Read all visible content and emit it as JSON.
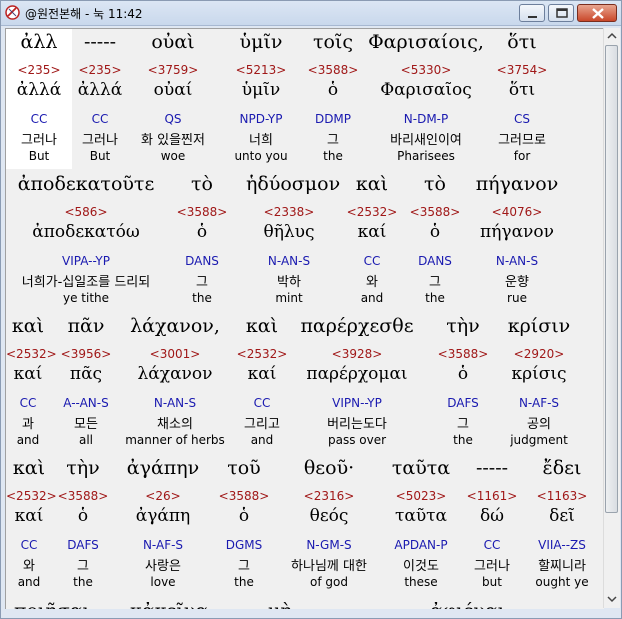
{
  "window": {
    "title": "@원전본해 - 눅 11:42"
  },
  "lines": [
    {
      "words": [
        {
          "greek": "ἀλλ",
          "num": "<235>",
          "lex": "ἀλλά",
          "pars": "CC",
          "kor": "그러나",
          "eng": "But"
        },
        {
          "greek": "-----",
          "num": "<235>",
          "lex": "ἀλλά",
          "pars": "CC",
          "kor": "그러나",
          "eng": "But"
        },
        {
          "greek": "οὐαὶ",
          "num": "<3759>",
          "lex": "οὐαί",
          "pars": "QS",
          "kor": "화 있을찐저",
          "eng": "woe"
        },
        {
          "greek": "ὑμῖν",
          "num": "<5213>",
          "lex": "ὑμῖν",
          "pars": "NPD-YP",
          "kor": "너희",
          "eng": "unto you"
        },
        {
          "greek": "τοῖς",
          "num": "<3588>",
          "lex": "ὁ",
          "pars": "DDMP",
          "kor": "그",
          "eng": "the"
        },
        {
          "greek": "Φαρισαίοις,",
          "num": "<5330>",
          "lex": "Φαρισαῖος",
          "pars": "N-DM-P",
          "kor": "바리새인이여",
          "eng": "Pharisees"
        },
        {
          "greek": "ὅτι",
          "num": "<3754>",
          "lex": "ὅτι",
          "pars": "CS",
          "kor": "그러므로",
          "eng": "for"
        }
      ]
    },
    {
      "words": [
        {
          "greek": "ἀποδεκατοῦτε",
          "num": "<586>",
          "lex": "ἀποδεκατόω",
          "pars": "VIPA--YP",
          "kor": "너희가-십일조를 드리되",
          "eng": "ye tithe"
        },
        {
          "greek": "τὸ",
          "num": "<3588>",
          "lex": "ὁ",
          "pars": "DANS",
          "kor": "그",
          "eng": "the"
        },
        {
          "greek": "ἡδύοσμον",
          "num": "<2338>",
          "lex": "θῆλυς",
          "pars": "N-AN-S",
          "kor": "박하",
          "eng": "mint"
        },
        {
          "greek": "καὶ",
          "num": "<2532>",
          "lex": "καί",
          "pars": "CC",
          "kor": "와",
          "eng": "and"
        },
        {
          "greek": "τὸ",
          "num": "<3588>",
          "lex": "ὁ",
          "pars": "DANS",
          "kor": "그",
          "eng": "the"
        },
        {
          "greek": "πήγανον",
          "num": "<4076>",
          "lex": "πήγανον",
          "pars": "N-AN-S",
          "kor": "운향",
          "eng": "rue"
        }
      ]
    },
    {
      "words": [
        {
          "greek": "καὶ",
          "num": "<2532>",
          "lex": "καί",
          "pars": "CC",
          "kor": "과",
          "eng": "and"
        },
        {
          "greek": "πᾶν",
          "num": "<3956>",
          "lex": "πᾶς",
          "pars": "A--AN-S",
          "kor": "모든",
          "eng": "all"
        },
        {
          "greek": "λάχανον,",
          "num": "<3001>",
          "lex": "λάχανον",
          "pars": "N-AN-S",
          "kor": "채소의",
          "eng": "manner of herbs"
        },
        {
          "greek": "καὶ",
          "num": "<2532>",
          "lex": "καί",
          "pars": "CC",
          "kor": "그리고",
          "eng": "and"
        },
        {
          "greek": "παρέρχεσθε",
          "num": "<3928>",
          "lex": "παρέρχομαι",
          "pars": "VIPN--YP",
          "kor": "버리는도다",
          "eng": "pass over"
        },
        {
          "greek": "τὴν",
          "num": "<3588>",
          "lex": "ὁ",
          "pars": "DAFS",
          "kor": "그",
          "eng": "the"
        },
        {
          "greek": "κρίσιν",
          "num": "<2920>",
          "lex": "κρίσις",
          "pars": "N-AF-S",
          "kor": "공의",
          "eng": "judgment"
        }
      ]
    },
    {
      "words": [
        {
          "greek": "καὶ",
          "num": "<2532>",
          "lex": "καί",
          "pars": "CC",
          "kor": "와",
          "eng": "and"
        },
        {
          "greek": "τὴν",
          "num": "<3588>",
          "lex": "ὁ",
          "pars": "DAFS",
          "kor": "그",
          "eng": "the"
        },
        {
          "greek": "ἀγάπην",
          "num": "<26>",
          "lex": "ἀγάπη",
          "pars": "N-AF-S",
          "kor": "사랑은",
          "eng": "love"
        },
        {
          "greek": "τοῦ",
          "num": "<3588>",
          "lex": "ὁ",
          "pars": "DGMS",
          "kor": "그",
          "eng": "the"
        },
        {
          "greek": "θεοῦ·",
          "num": "<2316>",
          "lex": "θεός",
          "pars": "N-GM-S",
          "kor": "하나님께 대한",
          "eng": "of god"
        },
        {
          "greek": "ταῦτα",
          "num": "<5023>",
          "lex": "ταῦτα",
          "pars": "APDAN-P",
          "kor": "이것도",
          "eng": "these"
        },
        {
          "greek": "-----",
          "num": "<1161>",
          "lex": "δώ",
          "pars": "CC",
          "kor": "그러나",
          "eng": "but"
        },
        {
          "greek": "ἔδει",
          "num": "<1163>",
          "lex": "δεῖ",
          "pars": "VIIA--ZS",
          "kor": "할찌니라",
          "eng": "ought ye"
        }
      ]
    }
  ],
  "cutoff": [
    "ποιῆσαι",
    "κἀκεῖνα",
    "μὴ",
    "ἀφιέναι"
  ]
}
